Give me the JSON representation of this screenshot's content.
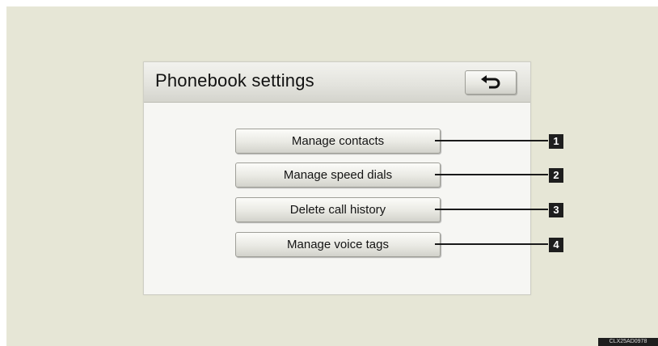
{
  "screen": {
    "title": "Phonebook settings",
    "back_icon": "return-arrow-icon"
  },
  "menu": {
    "items": [
      {
        "label": "Manage contacts",
        "callout": "1"
      },
      {
        "label": "Manage speed dials",
        "callout": "2"
      },
      {
        "label": "Delete call history",
        "callout": "3"
      },
      {
        "label": "Manage voice tags",
        "callout": "4"
      }
    ]
  },
  "figure_code": "CLX25AD0978"
}
